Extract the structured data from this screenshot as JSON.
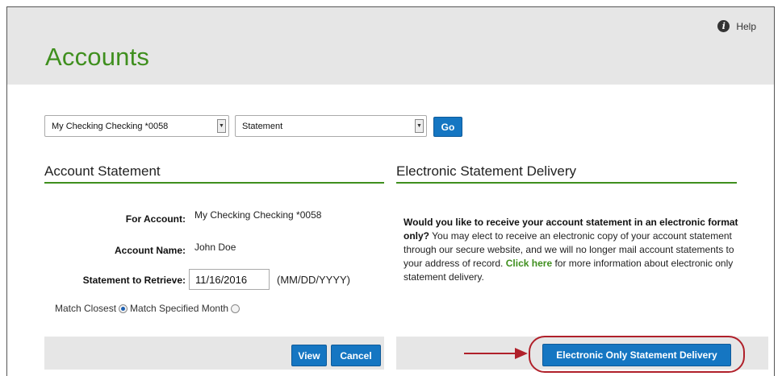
{
  "page": {
    "title": "Accounts",
    "help_label": "Help",
    "help_icon": "info-icon"
  },
  "selectors": {
    "account_value": "My Checking Checking *0058",
    "type_value": "Statement",
    "go_label": "Go"
  },
  "statement": {
    "section_title": "Account Statement",
    "for_account_label": "For Account:",
    "for_account_value": "My Checking Checking *0058",
    "account_name_label": "Account Name:",
    "account_name_value": "John Doe",
    "retrieve_label": "Statement to Retrieve:",
    "date_value": "11/16/2016",
    "date_format": "(MM/DD/YYYY)",
    "match_closest_label": "Match Closest",
    "match_specified_label": "Match Specified Month",
    "match_selected": "closest",
    "view_label": "View",
    "cancel_label": "Cancel"
  },
  "electronic": {
    "section_title": "Electronic Statement Delivery",
    "question": "Would you like to receive your account statement in an electronic format only?",
    "body_1": "You may elect to receive an electronic copy of your account statement through our secure website, and we will no longer mail account statements to your address of record.",
    "link_text": "Click here",
    "body_2": "for more information about electronic only statement delivery.",
    "button_label": "Electronic Only Statement Delivery"
  },
  "colors": {
    "brand_green": "#3f8f1e",
    "button_blue": "#1576c2",
    "annotation_red": "#b0202a",
    "header_gray": "#e6e6e6"
  }
}
